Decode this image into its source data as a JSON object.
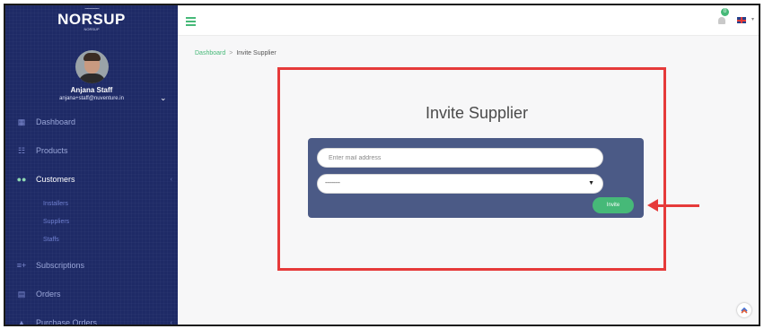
{
  "brand": {
    "name": "NORSUP",
    "wave": "~~~~~",
    "tagline": "NORSUP"
  },
  "user": {
    "name": "Anjana Staff",
    "email": "anjana+staff@nuventure.in"
  },
  "sidebar": {
    "items": [
      {
        "label": "Dashboard",
        "icon": "dashboard-icon"
      },
      {
        "label": "Products",
        "icon": "cart-icon"
      },
      {
        "label": "Customers",
        "icon": "users-icon",
        "active": true
      },
      {
        "label": "Subscriptions",
        "icon": "subscriptions-icon"
      },
      {
        "label": "Orders",
        "icon": "orders-icon"
      },
      {
        "label": "Purchase Orders",
        "icon": "basket-icon"
      }
    ],
    "customers_sub": [
      "Installers",
      "Suppliers",
      "Staffs"
    ]
  },
  "topbar": {
    "notification_count": "0",
    "language": "EN"
  },
  "breadcrumb": {
    "root": "Dashboard",
    "separator": ">",
    "current": "Invite Supplier"
  },
  "page": {
    "title": "Invite Supplier"
  },
  "form": {
    "email_placeholder": "Enter mail address",
    "select_value": "---------",
    "submit_label": "Invite"
  },
  "colors": {
    "sidebar_bg": "#1e2a66",
    "accent": "#46b978",
    "card_bg": "#4b5a86",
    "highlight": "#e63a3a"
  }
}
